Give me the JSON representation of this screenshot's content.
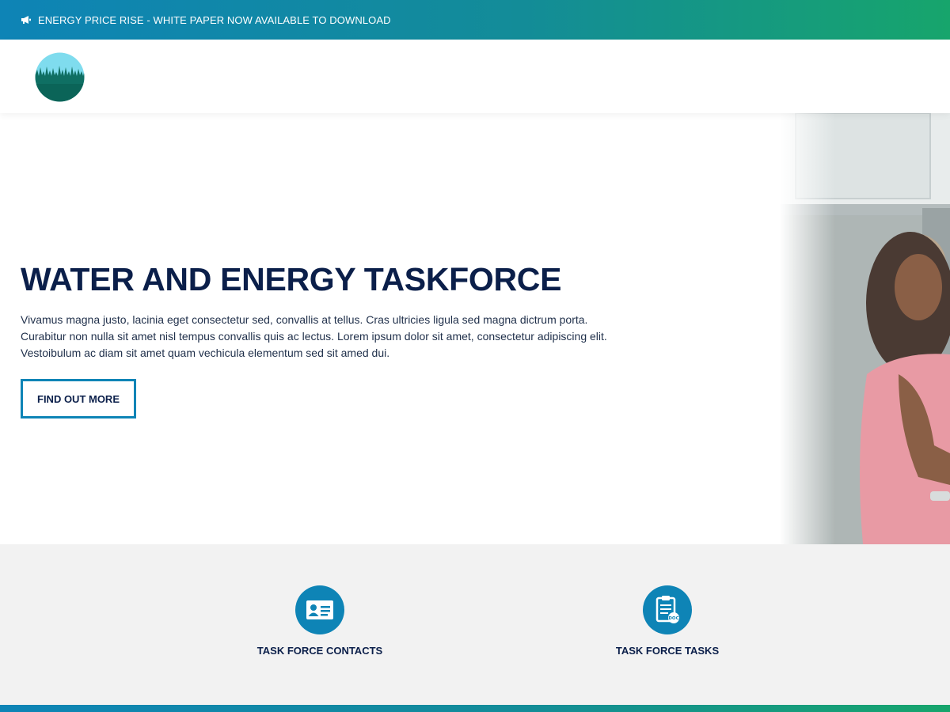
{
  "announcement": {
    "icon": "megaphone-icon",
    "text": "ENERGY PRICE RISE - WHITE PAPER NOW AVAILABLE TO DOWNLOAD"
  },
  "header": {
    "logo": "grass-circle-logo"
  },
  "hero": {
    "title": "WATER AND ENERGY TASKFORCE",
    "body": "Vivamus magna justo, lacinia eget consectetur sed, convallis at tellus. Cras ultricies ligula sed magna dictrum porta. Curabitur non nulla sit amet nisl tempus convallis quis ac lectus. Lorem ipsum dolor sit amet, consectetur adipiscing elit. Vestoibulum ac diam sit amet quam vechicula elementum sed sit amed dui.",
    "button_label": "FIND OUT MORE",
    "image": "child-at-sink-photo"
  },
  "features": [
    {
      "icon": "contact-card-icon",
      "label": "TASK FORCE CONTACTS"
    },
    {
      "icon": "document-clipboard-icon",
      "label": "TASK FORCE TASKS"
    }
  ],
  "colors": {
    "accent": "#0e84b6",
    "accent_green": "#17a56c",
    "heading": "#0b1f4a",
    "panel_bg": "#f2f2f2"
  }
}
